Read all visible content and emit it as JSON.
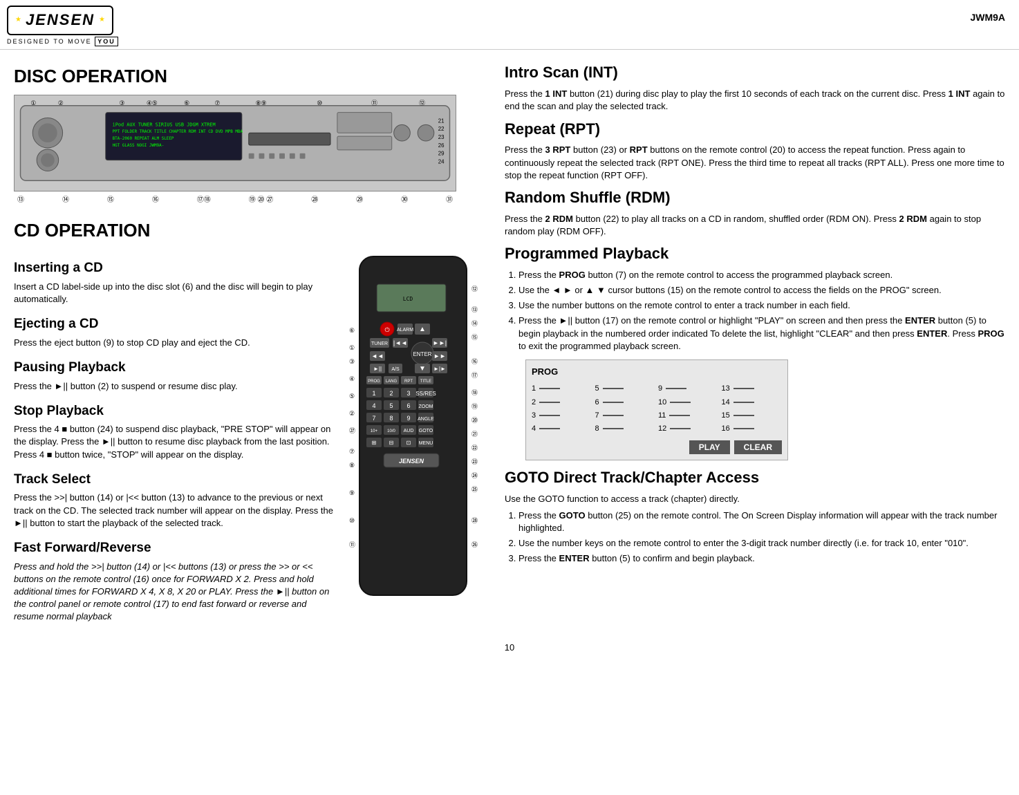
{
  "header": {
    "model": "JWM9A",
    "logo": "JENSEN",
    "designed_text": "DESIGNED TO MOVE",
    "you_text": "YOU"
  },
  "left": {
    "disc_operation_title": "DISC OPERATION",
    "cd_operation_title": "CD OPERATION",
    "sections": [
      {
        "id": "inserting",
        "title": "Inserting a CD",
        "body": "Insert a CD label-side up into the disc slot (6) and the disc will begin to play automatically."
      },
      {
        "id": "ejecting",
        "title": "Ejecting a CD",
        "body": "Press the eject button (9) to stop CD play and eject the CD."
      },
      {
        "id": "pausing",
        "title": "Pausing Playback",
        "body": "Press the ►|| button (2) to suspend or resume disc play."
      },
      {
        "id": "stop",
        "title": "Stop Playback",
        "body": "Press the 4 ■ button (24) to suspend disc playback, \"PRE STOP\" will appear on the display. Press the ►|| button to resume disc playback from the last position. Press 4 ■ button twice, \"STOP\" will appear on the display."
      },
      {
        "id": "track",
        "title": "Track Select",
        "body": "Press the >>| button (14) or |<< button (13) to advance to the previous or next track on the CD. The selected track number will appear on the display. Press the ►|| button to start the playback of the selected track."
      },
      {
        "id": "ffrev",
        "title": "Fast Forward/Reverse",
        "body_italic": "Press and hold the >>| button (14) or |<< buttons (13) or press the >> or << buttons on the remote control (16) once for FORWARD X 2. Press and hold additional times for FORWARD X 4, X 8, X 20 or PLAY. Press the ►|| button on the control panel or remote control (17) to end fast forward or reverse and resume normal playback"
      }
    ]
  },
  "right": {
    "sections": [
      {
        "id": "intro",
        "title": "Intro Scan (INT)",
        "body": "Press the 1 INT button (21) during disc play to play the first 10 seconds of each track on the current disc. Press 1 INT again to end the scan and play the selected track."
      },
      {
        "id": "repeat",
        "title": "Repeat (RPT)",
        "body": "Press the 3 RPT button (23) or RPT buttons on the remote control (20) to access the repeat function. Press again to continuously repeat the selected track (RPT ONE). Press the third time to repeat all tracks (RPT ALL). Press one more time to stop the repeat function (RPT OFF)."
      },
      {
        "id": "random",
        "title": "Random Shuffle (RDM)",
        "body": "Press the 2 RDM button (22) to play all tracks on a CD in random, shuffled order (RDM ON). Press 2 RDM again to stop random play (RDM OFF)."
      },
      {
        "id": "programmed",
        "title": "Programmed Playback",
        "steps": [
          "Press the PROG button (7) on the remote control to access the programmed playback screen.",
          "Use the ◄ ► or ▲ ▼ cursor buttons (15) on the remote control to access the fields on the PROG\" screen.",
          "Use the number buttons on the remote control to enter a track number in each field.",
          "Press the ►|| button (17) on the remote control or highlight \"PLAY\" on screen and then press the ENTER button (5) to begin playback in the numbered order indicated To delete the list, highlight \"CLEAR\" and then press ENTER. Press PROG to exit the programmed playback screen."
        ]
      },
      {
        "id": "goto",
        "title": "GOTO Direct Track/Chapter Access",
        "intro": "Use the GOTO function to access a track (chapter) directly.",
        "steps": [
          "Press the GOTO button (25) on the remote control. The On Screen Display information will appear with the track number highlighted.",
          "Use the number keys on the remote control to enter the 3-digit track number directly (i.e. for track 10, enter \"010\".",
          "Press the ENTER button (5) to confirm and begin playback."
        ]
      }
    ],
    "prog_screen": {
      "title": "PROG",
      "rows": [
        {
          "col1": "1 ——",
          "col2": "5 ——",
          "col3": "9 ——",
          "col4": "13 ——"
        },
        {
          "col1": "2 ——",
          "col2": "6 ——",
          "col3": "10 ——",
          "col4": "14 ——"
        },
        {
          "col1": "3 ——",
          "col2": "7 ——",
          "col3": "11 ——",
          "col4": "15 ——"
        },
        {
          "col1": "4 ——",
          "col2": "8 ——",
          "col3": "12 ——",
          "col4": "16 ——"
        }
      ],
      "play_btn": "PLAY",
      "clear_btn": "CLEAR"
    }
  },
  "page_number": "10"
}
